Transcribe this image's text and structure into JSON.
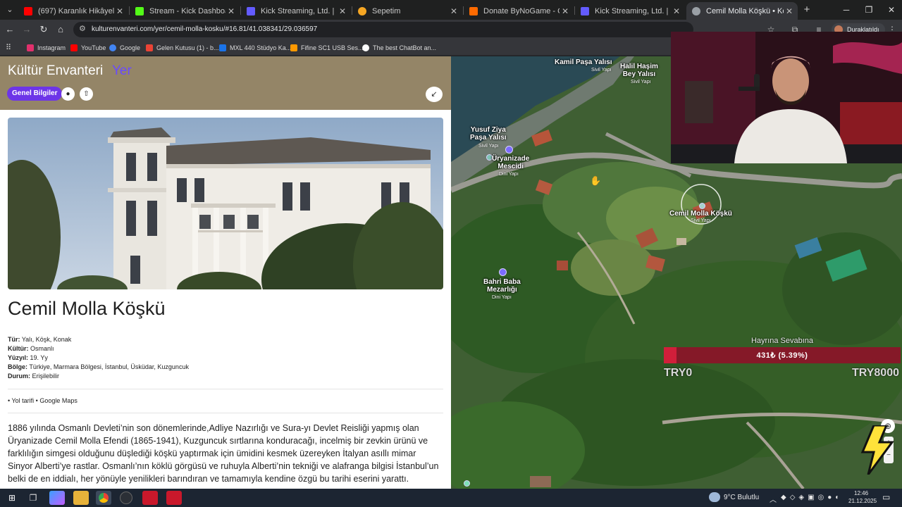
{
  "browser": {
    "tabs": [
      {
        "title": "(697) Karanlık Hikâyeler: Cemil M",
        "favicon_color": "#ff0000"
      },
      {
        "title": "Stream - Kick Dashboard",
        "favicon_color": "#53fc18"
      },
      {
        "title": "Kick Streaming, Ltd. | Set up pa",
        "favicon_color": "#635bff"
      },
      {
        "title": "Sepetim",
        "favicon_color": "#f5a623"
      },
      {
        "title": "Donate ByNoGame - Gelen/Gid",
        "favicon_color": "#ff6a00"
      },
      {
        "title": "Kick Streaming, Ltd. | Stripe ile",
        "favicon_color": "#635bff"
      },
      {
        "title": "Cemil Molla Köşkü • Konumu, F",
        "favicon_color": "#9aa0a6"
      }
    ],
    "url": "kulturenvanteri.com/yer/cemil-molla-kosku/#16.81/41.038341/29.036597",
    "profile_label": "Duraklatıldı",
    "bookmarks": [
      {
        "label": "Instagram",
        "color": "#e1306c"
      },
      {
        "label": "YouTube",
        "color": "#ff0000"
      },
      {
        "label": "Google",
        "color": "#4285f4"
      },
      {
        "label": "Gelen Kutusu (1) - b...",
        "color": "#ea4335"
      },
      {
        "label": "MXL 440 Stüdyo Ka...",
        "color": "#1a73e8"
      },
      {
        "label": "Fifine SC1 USB Ses...",
        "color": "#ff9900"
      },
      {
        "label": "The best ChatBot an...",
        "color": "#ffffff"
      }
    ]
  },
  "site": {
    "brand": "Kültür Envanteri",
    "brand_accent": "Yer",
    "general_info_btn": "Genel Bilgiler",
    "place_title": "Cemil Molla Köşkü",
    "properties": [
      {
        "key": "Tür:",
        "value": "Yalı, Köşk, Konak"
      },
      {
        "key": "Kültür:",
        "value": "Osmanlı"
      },
      {
        "key": "Yüzyıl:",
        "value": "19. Yy"
      },
      {
        "key": "Bölge:",
        "value": "Türkiye, Marmara Bölgesi, İstanbul, Üsküdar, Kuzguncuk"
      },
      {
        "key": "Durum:",
        "value": "Erişilebilir"
      }
    ],
    "links_text": "• Yol tarifi • Google Maps",
    "description": "1886 yılında Osmanlı Devleti’nin son dönemlerinde,Adliye Nazırlığı ve Sura-yı Devlet Reisliği yapmış olan Üryanizade Cemil Molla Efendi (1865-1941), Kuzguncuk sırtlarına konduracağı, incelmiş bir zevkin ürünü ve farklılığın simgesi olduğunu düşlediği köşkü yaptırmak için ümidini kesmek üzereyken İtalyan asıllı mimar Sinyor Alberti’ye rastlar. Osmanlı’nın köklü görgüsü ve ruhuyla Alberti’nin tekniği ve alafranga bilgisi İstanbul’un belki de en iddialı, her yönüyle yenilikleri barındıran ve tamamıyla kendine özgü bu tarihi eserini yarattı."
  },
  "map": {
    "labels": [
      {
        "name": "Kamil Paşa Yalısı",
        "sub": "Sivil Yapı"
      },
      {
        "name": "Halil Haşim\nBey Yalısı",
        "sub": "Sivil Yapı"
      },
      {
        "name": "Yusuf Ziya\nPaşa Yalısı",
        "sub": "Sivil Yapı"
      },
      {
        "name": "Üryanizade\nMescidi",
        "sub": "Dini Yapı"
      },
      {
        "name": "Cemil Molla Köşkü",
        "sub": "Sivil Yapı"
      },
      {
        "name": "Bahri Baba\nMezarlığı",
        "sub": "Dini Yapı"
      }
    ]
  },
  "donation": {
    "title": "Hayrına Sevabına",
    "amount_text": "431₺ (5.39%)",
    "progress": 0.0539,
    "min_label": "TRY0",
    "max_label": "TRY8000"
  },
  "taskbar": {
    "weather": "9°C  Bulutlu",
    "time": "12:46",
    "date": "21.12.2025"
  }
}
